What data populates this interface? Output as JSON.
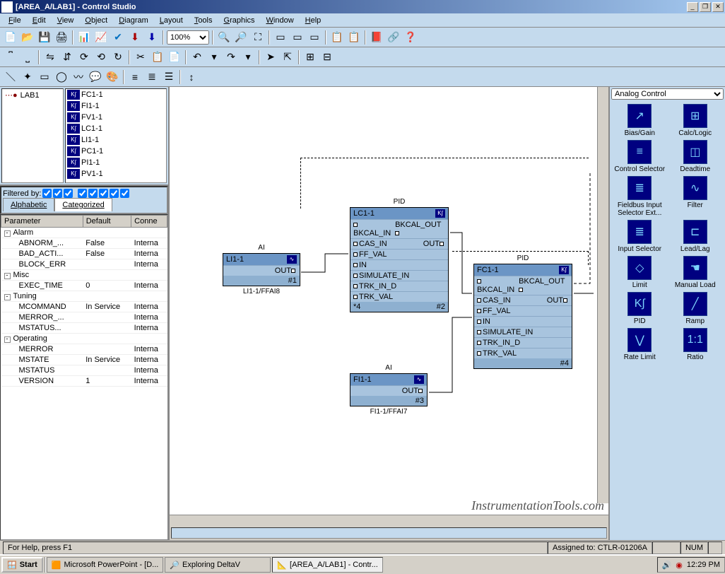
{
  "title": "[AREA_A/LAB1] - Control Studio",
  "menus": [
    "File",
    "Edit",
    "View",
    "Object",
    "Diagram",
    "Layout",
    "Tools",
    "Graphics",
    "Window",
    "Help"
  ],
  "zoom": "100%",
  "tree_root": "LAB1",
  "tree_items": [
    "FC1-1",
    "FI1-1",
    "FV1-1",
    "LC1-1",
    "LI1-1",
    "PC1-1",
    "PI1-1",
    "PV1-1"
  ],
  "filter_label": "Filtered by:",
  "tabs": {
    "alpha": "Alphabetic",
    "cat": "Categorized"
  },
  "param_headers": [
    "Parameter",
    "Default",
    "Conne"
  ],
  "param_groups": [
    {
      "name": "Alarm",
      "rows": [
        {
          "p": "ABNORM_...",
          "d": "False",
          "c": "Interna"
        },
        {
          "p": "BAD_ACTI...",
          "d": "False",
          "c": "Interna"
        },
        {
          "p": "BLOCK_ERR",
          "d": "",
          "c": "Interna"
        }
      ]
    },
    {
      "name": "Misc",
      "rows": [
        {
          "p": "EXEC_TIME",
          "d": "0",
          "c": "Interna"
        }
      ]
    },
    {
      "name": "Tuning",
      "rows": [
        {
          "p": "MCOMMAND",
          "d": "In Service",
          "c": "Interna"
        },
        {
          "p": "MERROR_...",
          "d": "",
          "c": "Interna"
        },
        {
          "p": "MSTATUS...",
          "d": "",
          "c": "Interna"
        }
      ]
    },
    {
      "name": "Operating",
      "rows": [
        {
          "p": "MERROR",
          "d": "",
          "c": "Interna"
        },
        {
          "p": "MSTATE",
          "d": "In Service",
          "c": "Interna"
        },
        {
          "p": "MSTATUS",
          "d": "",
          "c": "Interna"
        },
        {
          "p": "VERSION",
          "d": "1",
          "c": "Interna"
        }
      ]
    }
  ],
  "blocks": {
    "ai1": {
      "type": "AI",
      "name": "LI1-1",
      "footer_r": "#1",
      "label": "LI1-1/FFAI8",
      "rows": [
        {
          "l": "",
          "r": "OUT"
        }
      ]
    },
    "pid1": {
      "type": "PID",
      "name": "LC1-1",
      "footer_l": "*4",
      "footer_r": "#2",
      "rows": [
        {
          "l": "BKCAL_IN",
          "r": "BKCAL_OUT"
        },
        {
          "l": "CAS_IN",
          "r": "OUT"
        },
        {
          "l": "FF_VAL",
          "r": ""
        },
        {
          "l": "IN",
          "r": ""
        },
        {
          "l": "SIMULATE_IN",
          "r": ""
        },
        {
          "l": "TRK_IN_D",
          "r": ""
        },
        {
          "l": "TRK_VAL",
          "r": ""
        }
      ]
    },
    "ai2": {
      "type": "AI",
      "name": "FI1-1",
      "footer_r": "#3",
      "label": "FI1-1/FFAI7",
      "rows": [
        {
          "l": "",
          "r": "OUT"
        }
      ]
    },
    "pid2": {
      "type": "PID",
      "name": "FC1-1",
      "footer_r": "#4",
      "rows": [
        {
          "l": "BKCAL_IN",
          "r": "BKCAL_OUT"
        },
        {
          "l": "CAS_IN",
          "r": "OUT"
        },
        {
          "l": "FF_VAL",
          "r": ""
        },
        {
          "l": "IN",
          "r": ""
        },
        {
          "l": "SIMULATE_IN",
          "r": ""
        },
        {
          "l": "TRK_IN_D",
          "r": ""
        },
        {
          "l": "TRK_VAL",
          "r": ""
        }
      ]
    }
  },
  "palette_category": "Analog Control",
  "palette_items": [
    {
      "label": "Bias/Gain",
      "glyph": "↗"
    },
    {
      "label": "Calc/Logic",
      "glyph": "⊞"
    },
    {
      "label": "Control Selector",
      "glyph": "≡"
    },
    {
      "label": "Deadtime",
      "glyph": "◫"
    },
    {
      "label": "Fieldbus Input Selector Ext...",
      "glyph": "≣"
    },
    {
      "label": "Filter",
      "glyph": "∿"
    },
    {
      "label": "Input Selector",
      "glyph": "≣"
    },
    {
      "label": "Lead/Lag",
      "glyph": "⊏"
    },
    {
      "label": "Limit",
      "glyph": "◇"
    },
    {
      "label": "Manual Load",
      "glyph": "☚"
    },
    {
      "label": "PID",
      "glyph": "K∫"
    },
    {
      "label": "Ramp",
      "glyph": "╱"
    },
    {
      "label": "Rate Limit",
      "glyph": "⋁"
    },
    {
      "label": "Ratio",
      "glyph": "1:1"
    }
  ],
  "status_help": "For Help, press F1",
  "status_assigned": "Assigned to: CTLR-01206A",
  "status_num": "NUM",
  "taskbar": {
    "start": "Start",
    "items": [
      {
        "label": "Microsoft PowerPoint - [D...",
        "icon": "🟧"
      },
      {
        "label": "Exploring DeltaV",
        "icon": "🔎"
      },
      {
        "label": "[AREA_A/LAB1] - Contr...",
        "icon": "📐",
        "active": true
      }
    ],
    "watermark": "InstrumentationTools.com",
    "clock": "12:29 PM"
  }
}
